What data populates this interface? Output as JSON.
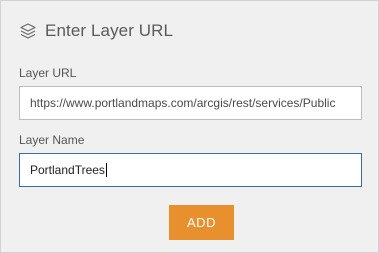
{
  "header": {
    "icon": "layers-icon",
    "title": "Enter Layer URL"
  },
  "layer_url": {
    "label": "Layer URL",
    "value": "https://www.portlandmaps.com/arcgis/rest/services/Public"
  },
  "layer_name": {
    "label": "Layer Name",
    "value": "PortlandTrees"
  },
  "actions": {
    "add_label": "ADD"
  },
  "colors": {
    "panel_bg": "#f0f0f0",
    "accent_button": "#e8902e",
    "focus_border": "#3a6e9e"
  }
}
